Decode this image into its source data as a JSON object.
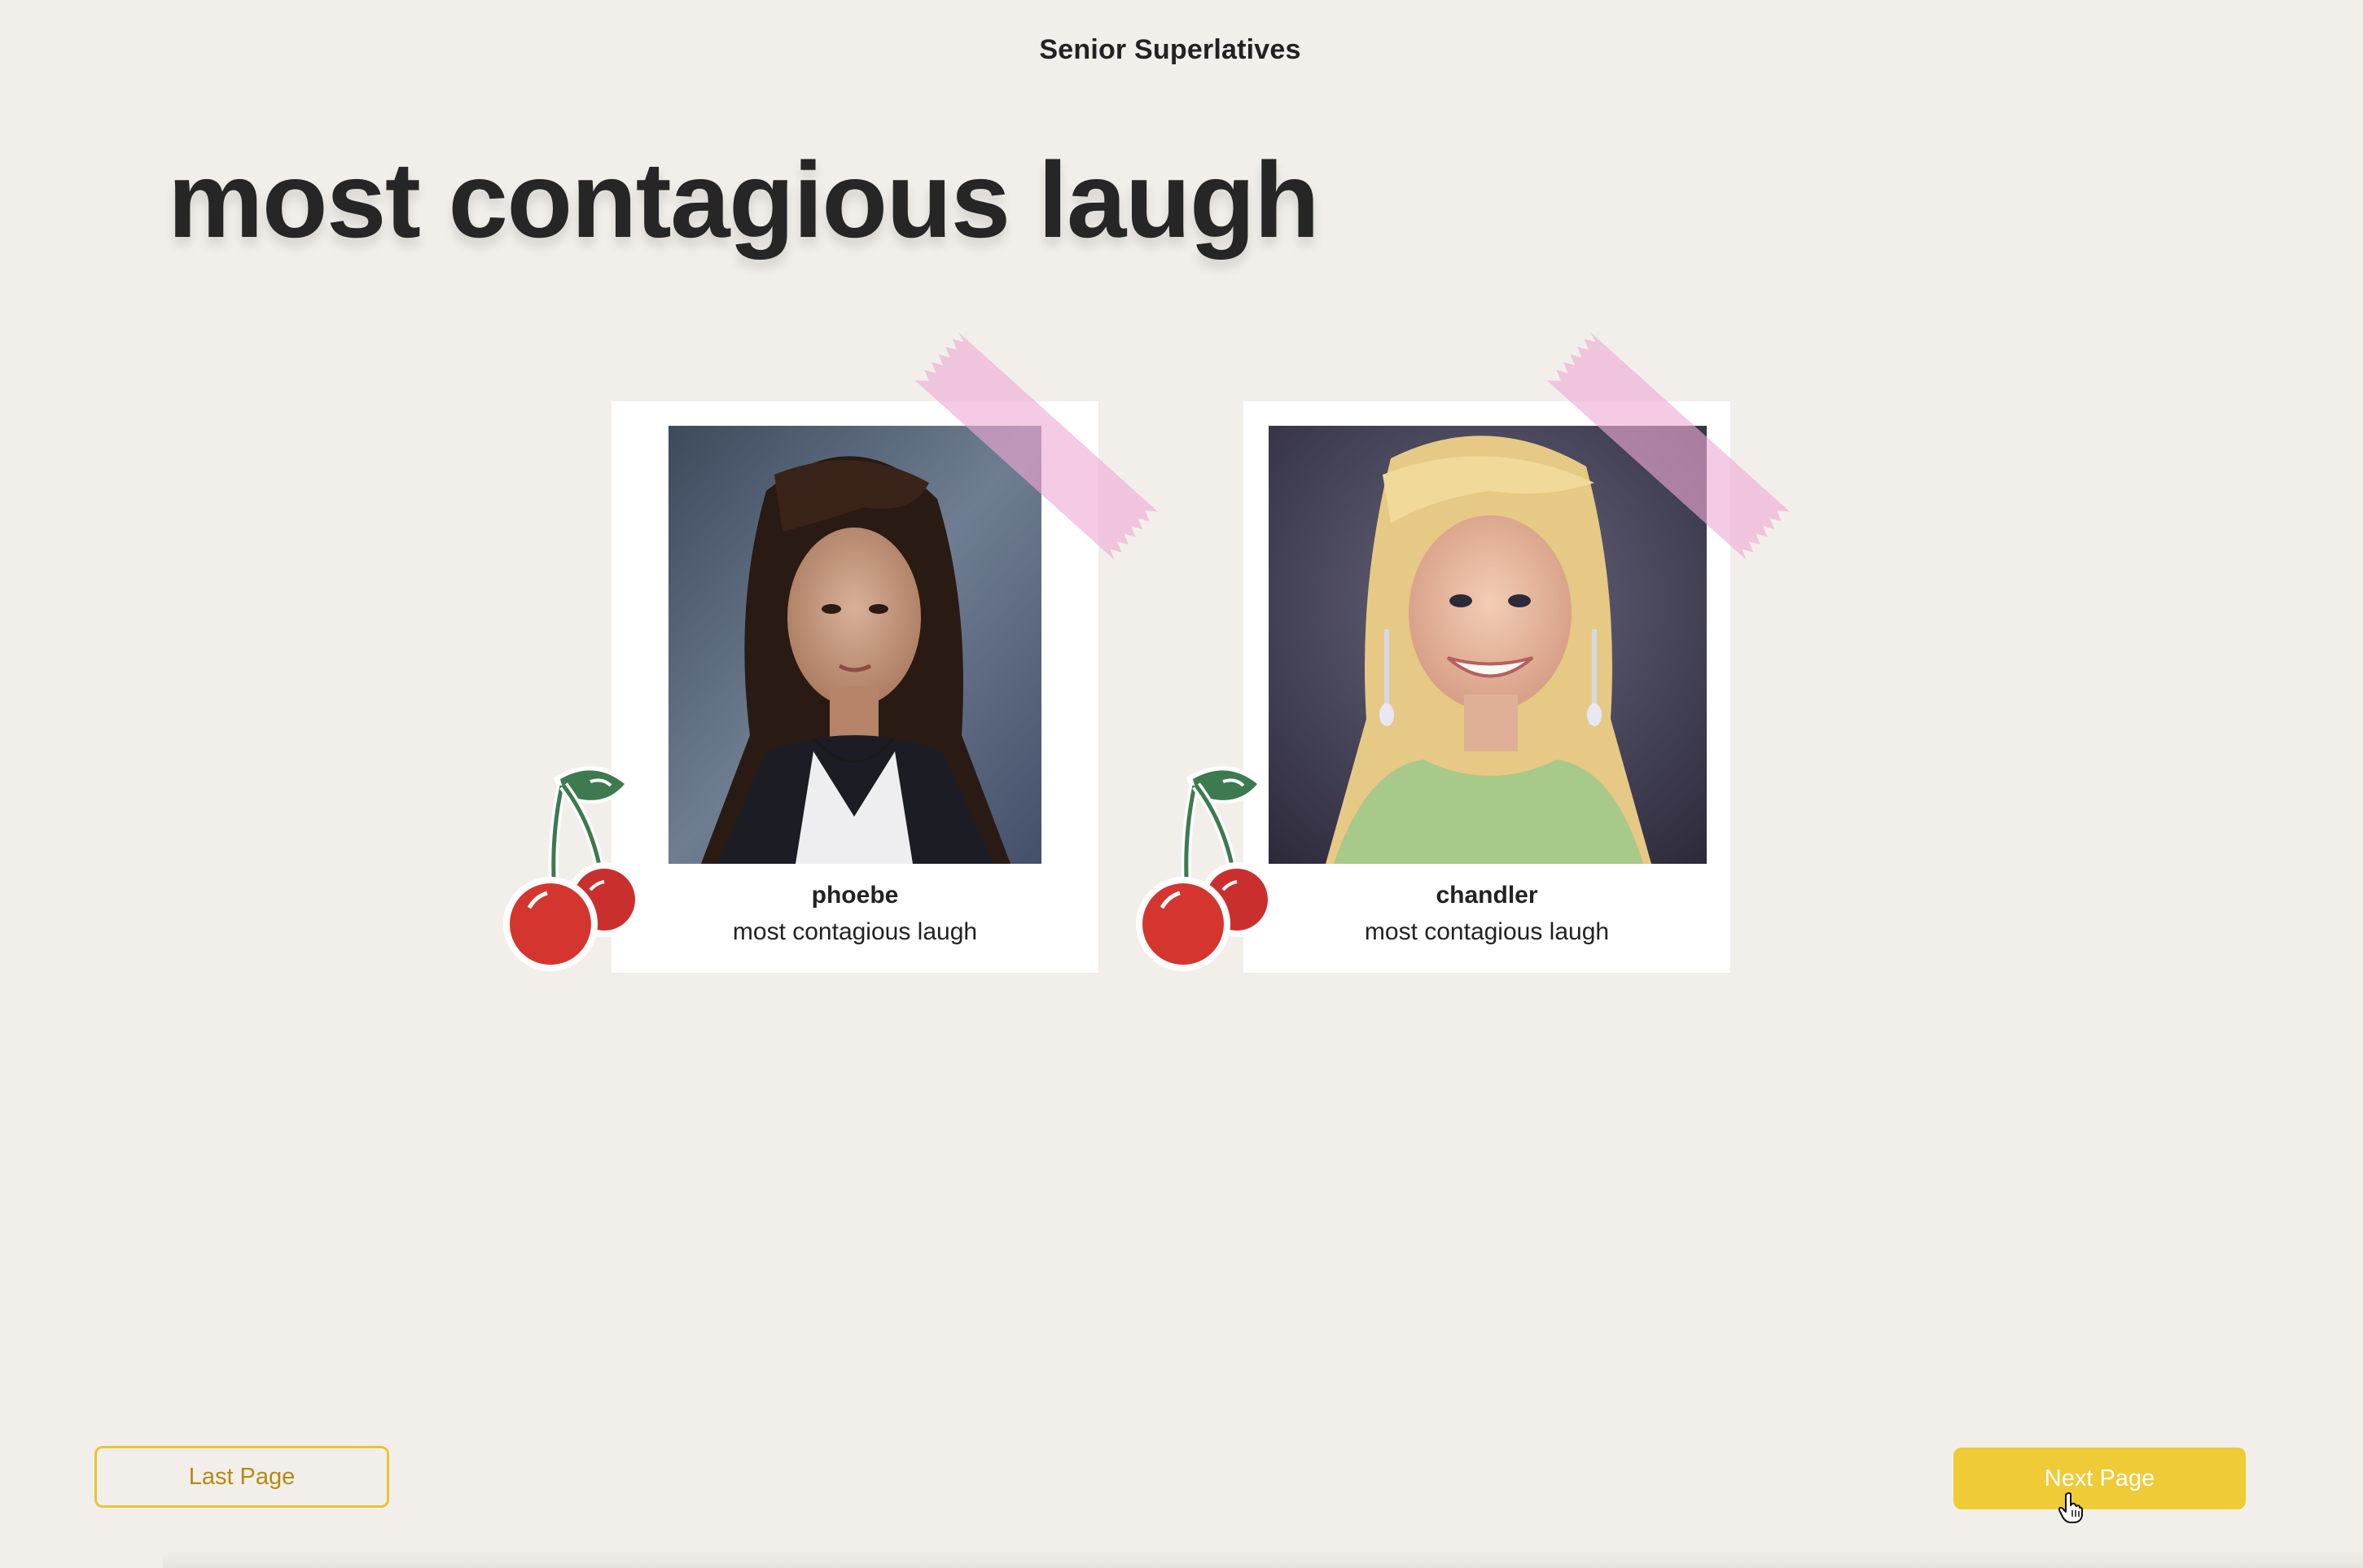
{
  "app": {
    "title": "Senior Superlatives"
  },
  "page": {
    "heading": "most contagious laugh"
  },
  "cards": [
    {
      "name": "phoebe",
      "award": "most contagious laugh",
      "photo_icon": "yearbook-portrait"
    },
    {
      "name": "chandler",
      "award": "most contagious laugh",
      "photo_icon": "yearbook-portrait"
    }
  ],
  "decorations": {
    "tape_color": "#eeaad4",
    "cherry_color": "#d0322f",
    "leaf_color": "#3d7a4f"
  },
  "navigation": {
    "last_label": "Last Page",
    "next_label": "Next Page",
    "accent_color": "#eecb37"
  },
  "colors": {
    "background": "#f2efea"
  }
}
